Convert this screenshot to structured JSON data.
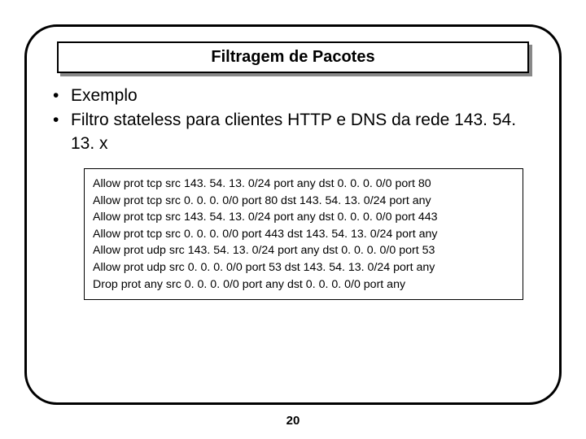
{
  "title": "Filtragem de Pacotes",
  "bullets": [
    "Exemplo",
    "Filtro stateless para clientes HTTP e DNS da rede 143. 54. 13. x"
  ],
  "rules": [
    "Allow prot tcp src 143. 54. 13. 0/24 port any dst 0. 0. 0. 0/0 port 80",
    "Allow prot tcp src 0. 0. 0. 0/0 port 80 dst 143. 54. 13. 0/24 port any",
    "Allow prot tcp src 143. 54. 13. 0/24 port any dst 0. 0. 0. 0/0 port 443",
    "Allow prot tcp src 0. 0. 0. 0/0 port 443 dst 143. 54. 13. 0/24 port any",
    "Allow prot udp src 143. 54. 13. 0/24 port any dst 0. 0. 0. 0/0 port 53",
    "Allow prot udp src 0. 0. 0. 0/0 port 53 dst 143. 54. 13. 0/24 port any",
    "Drop  prot any src 0. 0. 0. 0/0  port any dst 0. 0. 0. 0/0 port any"
  ],
  "page_number": "20"
}
